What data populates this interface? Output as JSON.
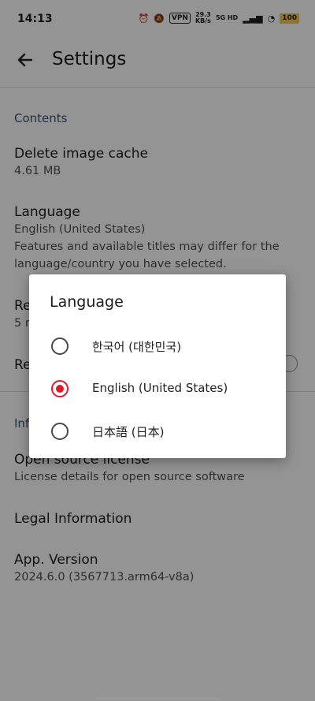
{
  "status_bar": {
    "time": "14:13",
    "vpn": "VPN",
    "net_speed_value": "29.3",
    "net_speed_unit": "KB/s",
    "network": "5G HD",
    "battery": "100"
  },
  "app_bar": {
    "title": "Settings"
  },
  "contents": {
    "section_title": "Contents",
    "delete_cache": {
      "title": "Delete image cache",
      "value": "4.61 MB"
    },
    "language": {
      "title": "Language",
      "value": "English (United States)",
      "note": "Features and available titles may differ for the language/country you have selected."
    },
    "hidden_item1": {
      "title": "Re",
      "value": "5 n"
    },
    "hidden_item2": {
      "title": "Re"
    }
  },
  "info": {
    "section_title": "Inf",
    "open_source": {
      "title": "Open source license",
      "value": "License details for open source software"
    },
    "legal": {
      "title": "Legal Information"
    },
    "version": {
      "title": "App. Version",
      "value": "2024.6.0 (3567713.arm64-v8a)"
    }
  },
  "dialog": {
    "title": "Language",
    "options": [
      {
        "label": "한국어 (대한민국)",
        "selected": false
      },
      {
        "label": "English (United States)",
        "selected": true
      },
      {
        "label": "日本語 (日本)",
        "selected": false
      }
    ],
    "accent_color": "#e0192b"
  }
}
